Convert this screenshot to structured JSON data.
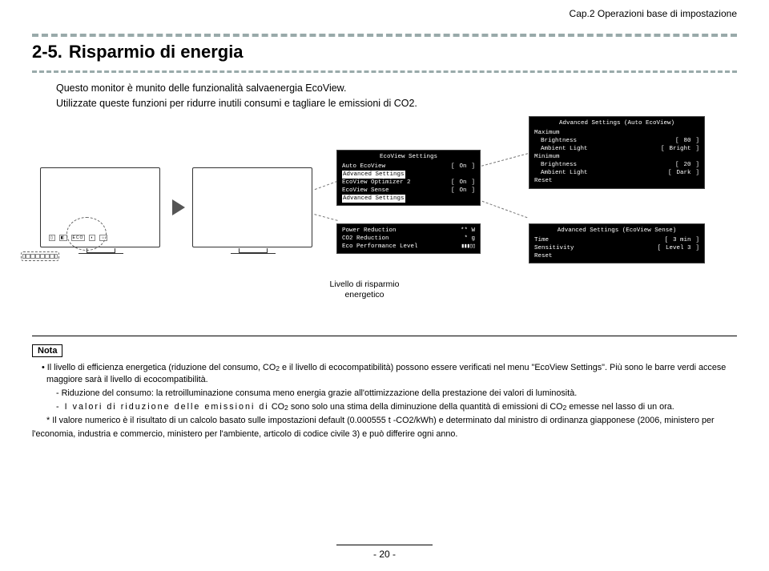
{
  "chapter_header": "Cap.2 Operazioni base di impostazione",
  "section_number": "2-5.",
  "section_title": "Risparmio di energia",
  "intro_line1": "Questo monitor è munito delle funzionalità salvaenergia EcoView.",
  "intro_line2": "Utilizzate queste funzioni per ridurre inutili consumi e tagliare le emissioni di CO2.",
  "osd_ecoview": {
    "title": "EcoView Settings",
    "rows": {
      "r0": "Auto EcoView",
      "r0v": "On",
      "r1": "Advanced Settings",
      "r2": "EcoView Optimizer 2",
      "r2v": "On",
      "r3": "EcoView Sense",
      "r3v": "On",
      "r4": "Advanced Settings"
    }
  },
  "osd_power": {
    "r0": "Power Reduction",
    "r0v": "** W",
    "r1": "CO2 Reduction",
    "r1v": "* g",
    "r2": "Eco Performance Level"
  },
  "osd_auto": {
    "title": "Advanced Settings (Auto EcoView)",
    "r0": "Maximum",
    "r1": "Brightness",
    "r1v": "80",
    "r2": "Ambient Light",
    "r2v": "Bright",
    "r3": "Minimum",
    "r4": "Brightness",
    "r4v": "20",
    "r5": "Ambient Light",
    "r5v": "Dark",
    "r6": "Reset"
  },
  "osd_sense": {
    "title": "Advanced Settings (EcoView Sense)",
    "r0": "Time",
    "r0v": "3 min",
    "r1": "Sensitivity",
    "r1v": "Level 3",
    "r2": "Reset"
  },
  "caption": "Livello di risparmio energetico",
  "nota_label": "Nota",
  "nota": {
    "p1a": "• Il livello di efficienza energetica (riduzione del consumo, CO",
    "p1b": " e il livello di ecocompatibilità) possono essere verificati nel menu \"EcoView Settings\". Più sono le barre verdi accese maggiore sarà il livello di ecocompatibilità.",
    "p2": "- Riduzione del consumo: la retroilluminazione consuma meno energia grazie all'ottimizzazione della prestazione dei valori di luminosità.",
    "p3a": "- I valori di riduzione delle emissioni di",
    "p3_co2": " CO",
    "p3b": " sono solo una stima della diminuzione della quantità di emissioni di CO",
    "p3c": " emesse nel lasso di un ora.",
    "p4a": "* Il valore numerico è il risultato di un calcolo basato sulle impostazioni default (0.000555 t -CO2/kWh) e determinato dal ministro di ordinanza giapponese (2006, ministero per",
    "p4b": "l'economia, industria e commercio, ministero per l'ambiente, articolo di codice civile 3) e può differire ogni anno."
  },
  "page_number": "- 20 -"
}
